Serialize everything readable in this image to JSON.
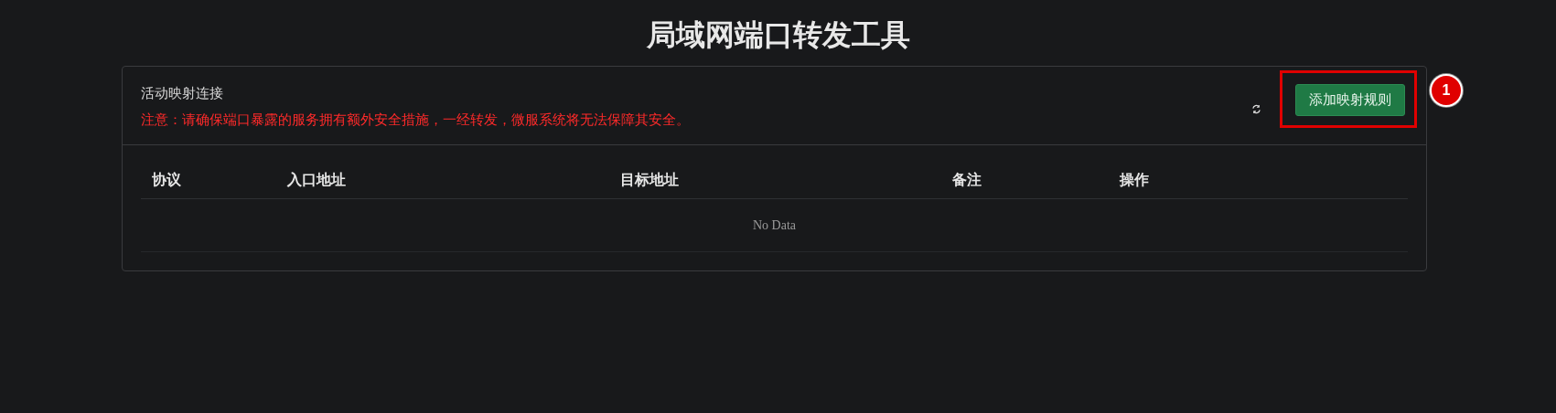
{
  "page_title": "局域网端口转发工具",
  "card": {
    "title": "活动映射连接",
    "warning": "注意：请确保端口暴露的服务拥有额外安全措施，一经转发，微服系统将无法保障其安全。",
    "add_button": "添加映射规则"
  },
  "table": {
    "columns": [
      "协议",
      "入口地址",
      "目标地址",
      "备注",
      "操作"
    ],
    "empty_text": "No Data"
  },
  "annotations": [
    {
      "label": "1"
    }
  ]
}
